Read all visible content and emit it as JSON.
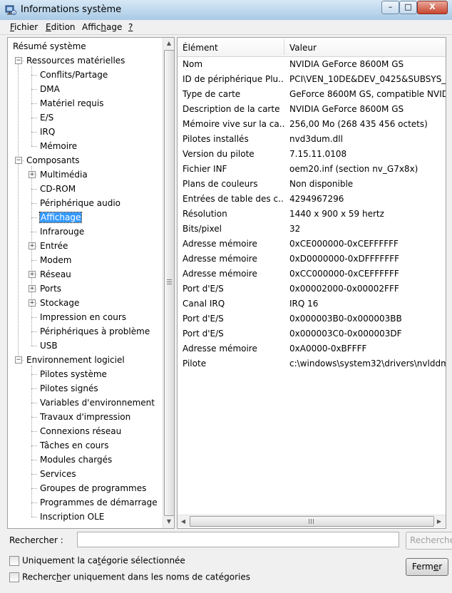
{
  "window": {
    "title": "Informations système",
    "minimize": "–",
    "maximize": "□",
    "close": "X"
  },
  "menu": [
    {
      "pre": "",
      "u": "F",
      "post": "ichier"
    },
    {
      "pre": "",
      "u": "E",
      "post": "dition"
    },
    {
      "pre": "Affic",
      "u": "h",
      "post": "age"
    },
    {
      "pre": "",
      "u": "?",
      "post": ""
    }
  ],
  "tree": {
    "root": "Résumé système",
    "items": [
      {
        "label": "Ressources matérielles",
        "level": 1,
        "expander": "−"
      },
      {
        "label": "Conflits/Partage",
        "level": 2,
        "expander": ""
      },
      {
        "label": "DMA",
        "level": 2,
        "expander": ""
      },
      {
        "label": "Matériel requis",
        "level": 2,
        "expander": ""
      },
      {
        "label": "E/S",
        "level": 2,
        "expander": ""
      },
      {
        "label": "IRQ",
        "level": 2,
        "expander": ""
      },
      {
        "label": "Mémoire",
        "level": 2,
        "expander": ""
      },
      {
        "label": "Composants",
        "level": 1,
        "expander": "−"
      },
      {
        "label": "Multimédia",
        "level": 2,
        "expander": "+"
      },
      {
        "label": "CD-ROM",
        "level": 2,
        "expander": ""
      },
      {
        "label": "Périphérique audio",
        "level": 2,
        "expander": ""
      },
      {
        "label": "Affichage",
        "level": 2,
        "expander": "",
        "selected": true
      },
      {
        "label": "Infrarouge",
        "level": 2,
        "expander": ""
      },
      {
        "label": "Entrée",
        "level": 2,
        "expander": "+"
      },
      {
        "label": "Modem",
        "level": 2,
        "expander": ""
      },
      {
        "label": "Réseau",
        "level": 2,
        "expander": "+"
      },
      {
        "label": "Ports",
        "level": 2,
        "expander": "+"
      },
      {
        "label": "Stockage",
        "level": 2,
        "expander": "+"
      },
      {
        "label": "Impression en cours",
        "level": 2,
        "expander": ""
      },
      {
        "label": "Périphériques à problème",
        "level": 2,
        "expander": ""
      },
      {
        "label": "USB",
        "level": 2,
        "expander": ""
      },
      {
        "label": "Environnement logiciel",
        "level": 1,
        "expander": "−"
      },
      {
        "label": "Pilotes système",
        "level": 2,
        "expander": ""
      },
      {
        "label": "Pilotes signés",
        "level": 2,
        "expander": ""
      },
      {
        "label": "Variables d'environnement",
        "level": 2,
        "expander": ""
      },
      {
        "label": "Travaux d'impression",
        "level": 2,
        "expander": ""
      },
      {
        "label": "Connexions réseau",
        "level": 2,
        "expander": ""
      },
      {
        "label": "Tâches en cours",
        "level": 2,
        "expander": ""
      },
      {
        "label": "Modules chargés",
        "level": 2,
        "expander": ""
      },
      {
        "label": "Services",
        "level": 2,
        "expander": ""
      },
      {
        "label": "Groupes de programmes",
        "level": 2,
        "expander": ""
      },
      {
        "label": "Programmes de démarrage",
        "level": 2,
        "expander": ""
      },
      {
        "label": "Inscription OLE",
        "level": 2,
        "expander": ""
      }
    ]
  },
  "list": {
    "headers": [
      "Élément",
      "Valeur"
    ],
    "rows": [
      [
        "Nom",
        "NVIDIA GeForce 8600M GS"
      ],
      [
        "ID de périphérique Plu...",
        "PCI\\VEN_10DE&DEV_0425&SUBSYS_C"
      ],
      [
        "Type de carte",
        "GeForce 8600M GS, compatible NVID"
      ],
      [
        "Description de la carte",
        "NVIDIA GeForce 8600M GS"
      ],
      [
        "Mémoire vive sur la ca...",
        "256,00 Mo (268 435 456 octets)"
      ],
      [
        "Pilotes installés",
        "nvd3dum.dll"
      ],
      [
        "Version du pilote",
        "7.15.11.0108"
      ],
      [
        "Fichier INF",
        "oem20.inf (section nv_G7x8x)"
      ],
      [
        "Plans de couleurs",
        "Non disponible"
      ],
      [
        "Entrées de table des c...",
        "4294967296"
      ],
      [
        "Résolution",
        "1440 x 900 x 59 hertz"
      ],
      [
        "Bits/pixel",
        "32"
      ],
      [
        "Adresse mémoire",
        "0xCE000000-0xCEFFFFFF"
      ],
      [
        "Adresse mémoire",
        "0xD0000000-0xDFFFFFFF"
      ],
      [
        "Adresse mémoire",
        "0xCC000000-0xCEFFFFFF"
      ],
      [
        "Port d'E/S",
        "0x00002000-0x00002FFF"
      ],
      [
        "Canal IRQ",
        "IRQ 16"
      ],
      [
        "Port d'E/S",
        "0x000003B0-0x000003BB"
      ],
      [
        "Port d'E/S",
        "0x000003C0-0x000003DF"
      ],
      [
        "Adresse mémoire",
        "0xA0000-0xBFFFF"
      ],
      [
        "Pilote",
        "c:\\windows\\system32\\drivers\\nvlddm"
      ]
    ]
  },
  "search": {
    "label_pre": "Rechercher :",
    "value": "",
    "find_button": "Rechercher"
  },
  "options": {
    "selected_only": {
      "pre": "Uniquement la ca",
      "u": "t",
      "post": "égorie sélectionnée",
      "checked": false
    },
    "names_only": {
      "pre": "Recherc",
      "u": "h",
      "post": "er uniquement dans les noms de catégories",
      "checked": false
    }
  },
  "close_button": {
    "pre": "Ferm",
    "u": "e",
    "post": "r"
  }
}
